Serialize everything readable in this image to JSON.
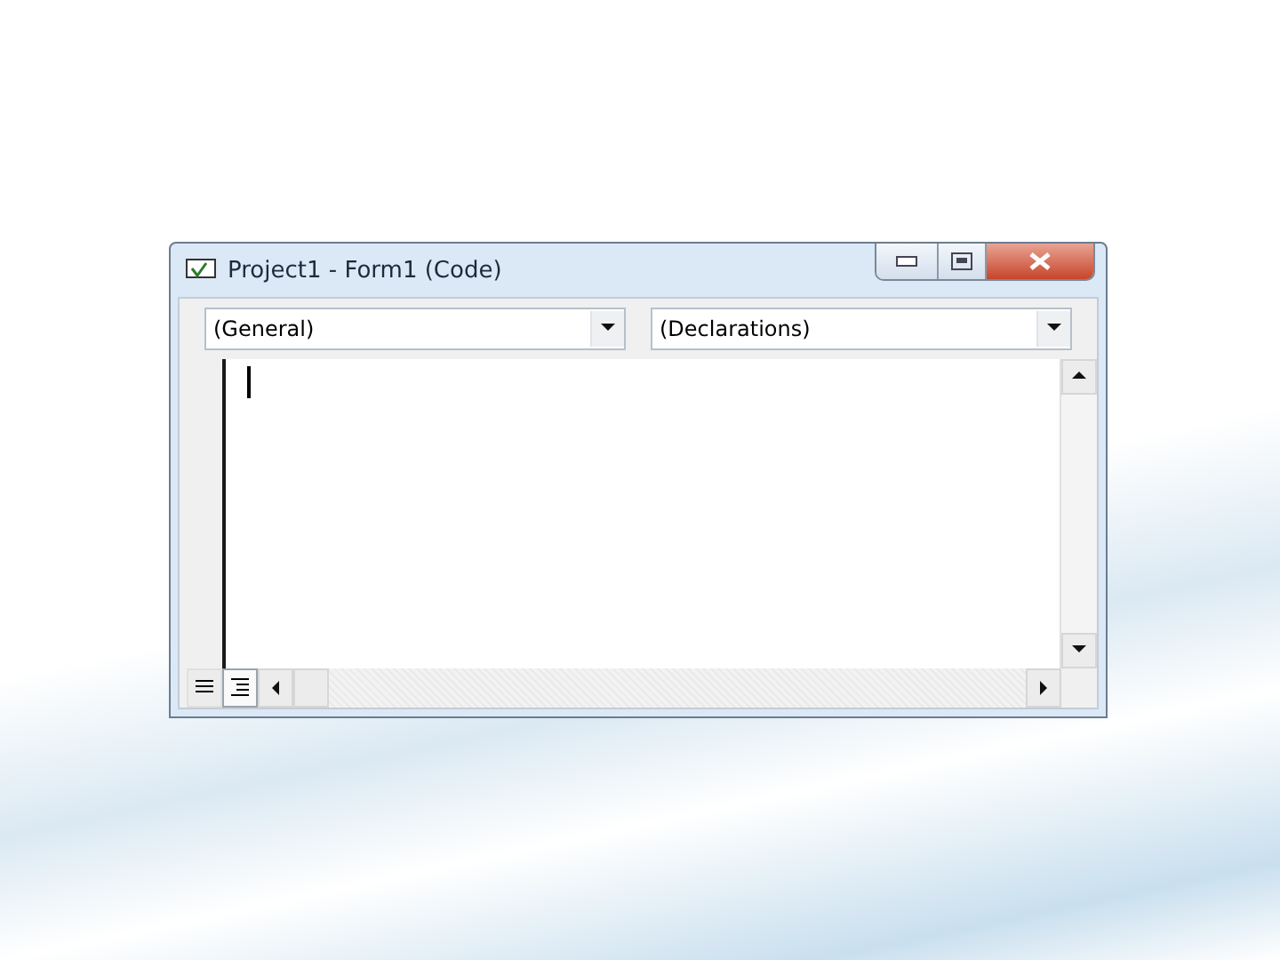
{
  "window": {
    "title": "Project1 - Form1 (Code)"
  },
  "dropdowns": [
    {
      "value": "(General)"
    },
    {
      "value": "(Declarations)"
    }
  ],
  "editor": {
    "cursor": true
  },
  "view_buttons": [
    {
      "kind": "procedure",
      "selected": false
    },
    {
      "kind": "module",
      "selected": true
    }
  ]
}
